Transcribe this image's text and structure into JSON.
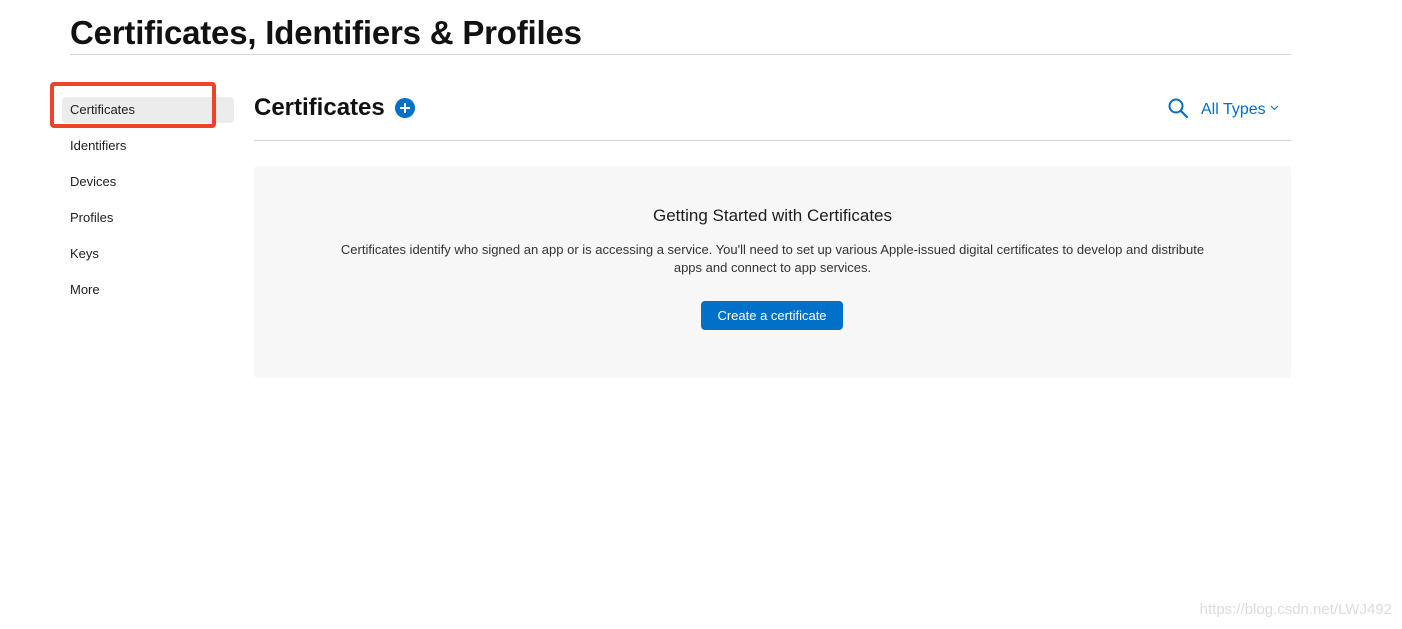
{
  "page": {
    "title": "Certificates, Identifiers & Profiles"
  },
  "sidebar": {
    "items": [
      {
        "label": "Certificates",
        "active": true
      },
      {
        "label": "Identifiers"
      },
      {
        "label": "Devices"
      },
      {
        "label": "Profiles"
      },
      {
        "label": "Keys"
      },
      {
        "label": "More"
      }
    ]
  },
  "main": {
    "title": "Certificates",
    "filter_label": "All Types",
    "empty_state": {
      "heading": "Getting Started with Certificates",
      "description": "Certificates identify who signed an app or is accessing a service. You'll need to set up various Apple-issued digital certificates to develop and distribute apps and connect to app services.",
      "button_label": "Create a certificate"
    }
  },
  "watermark": "https://blog.csdn.net/LWJ492",
  "colors": {
    "accent": "#0070c9",
    "annotation": "#f0412a",
    "panel_bg": "#f7f7f7"
  },
  "icons": {
    "add": "plus-circle-icon",
    "search": "search-icon",
    "filter_chevron": "chevron-down-icon"
  }
}
